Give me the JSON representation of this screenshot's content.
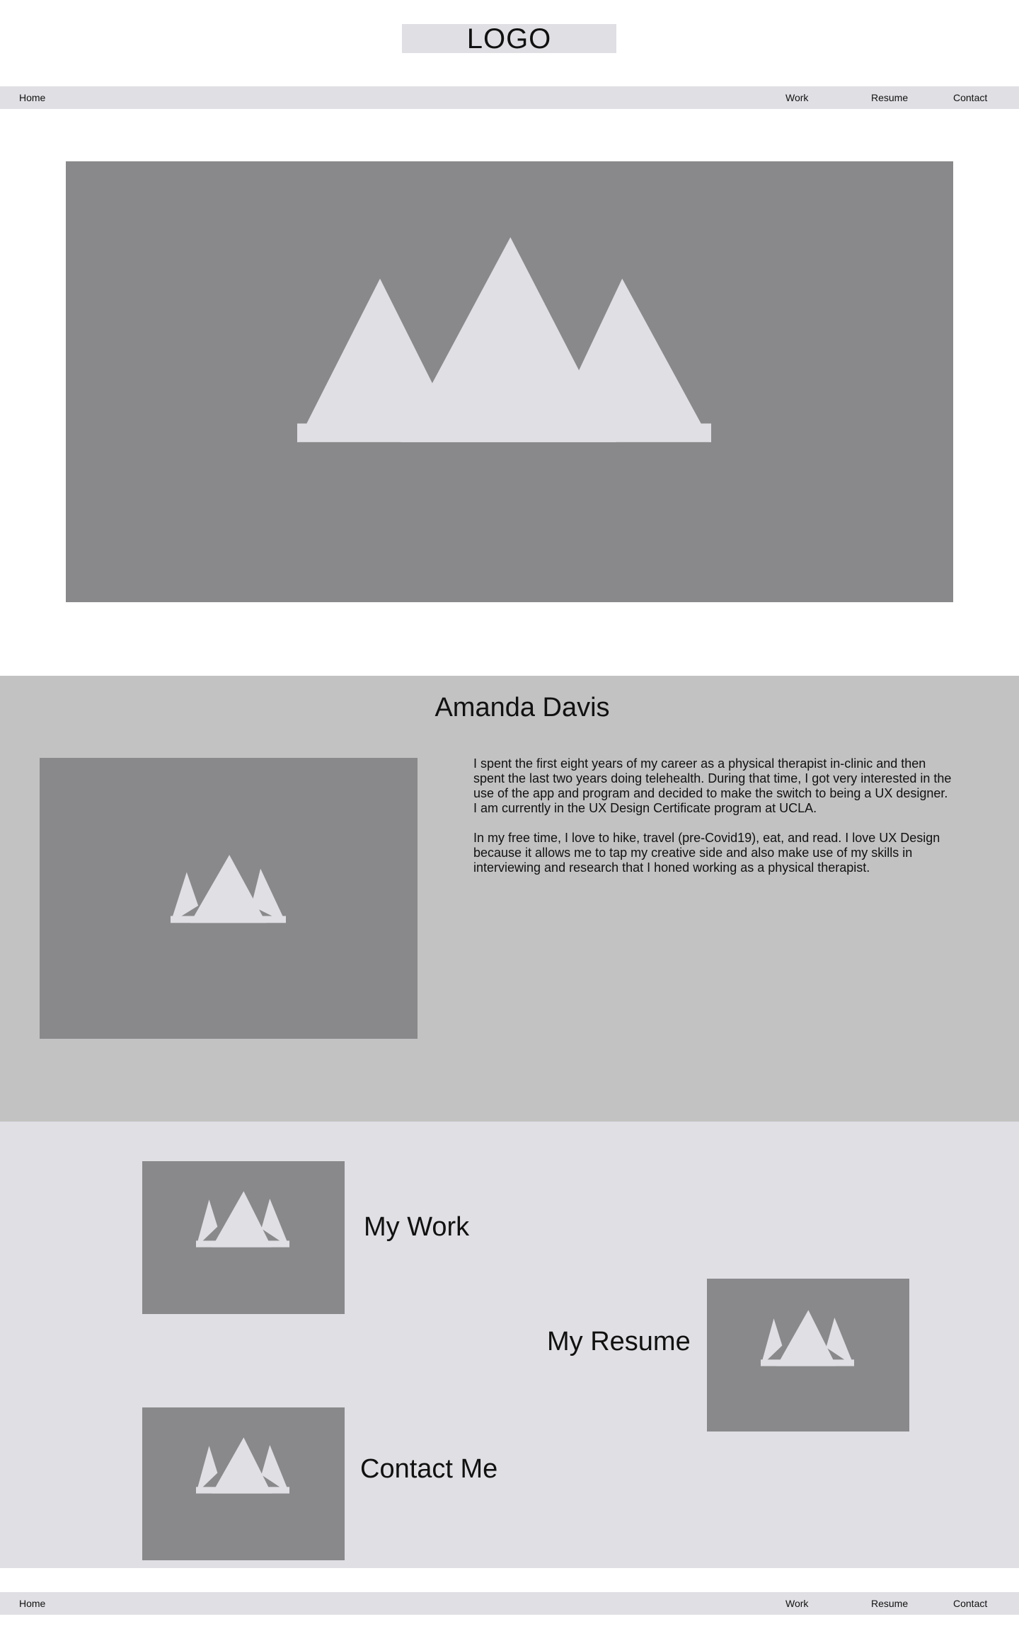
{
  "header": {
    "logo_text": "LOGO"
  },
  "nav": {
    "home": "Home",
    "work": "Work",
    "resume": "Resume",
    "contact": "Contact"
  },
  "hero": {
    "image": "image-placeholder-icon"
  },
  "about": {
    "name": "Amanda Davis",
    "paragraphs": [
      "I spent the first eight years of my career as a physical therapist in-clinic and then spent the last two years doing telehealth. During that time, I got very interested in the use of the app and program and decided to make the switch to being a UX designer. I am currently in the UX Design Certificate program at UCLA.",
      "In my free time, I love to hike, travel (pre-Covid19), eat, and read. I love UX Design because it allows me to tap my creative side and also make use of my skills in interviewing and research that I honed working as a physical therapist."
    ]
  },
  "links": {
    "work": "My Work",
    "resume": "My Resume",
    "contact": "Contact Me"
  },
  "footer_nav": {
    "home": "Home",
    "work": "Work",
    "resume": "Resume",
    "contact": "Contact"
  },
  "colors": {
    "nav_bg": "#e0dfe4",
    "placeholder": "#89898b",
    "placeholder_icon": "#e0dfe4",
    "about_bg": "#c2c2c2",
    "links_bg": "#e0dfe4"
  }
}
